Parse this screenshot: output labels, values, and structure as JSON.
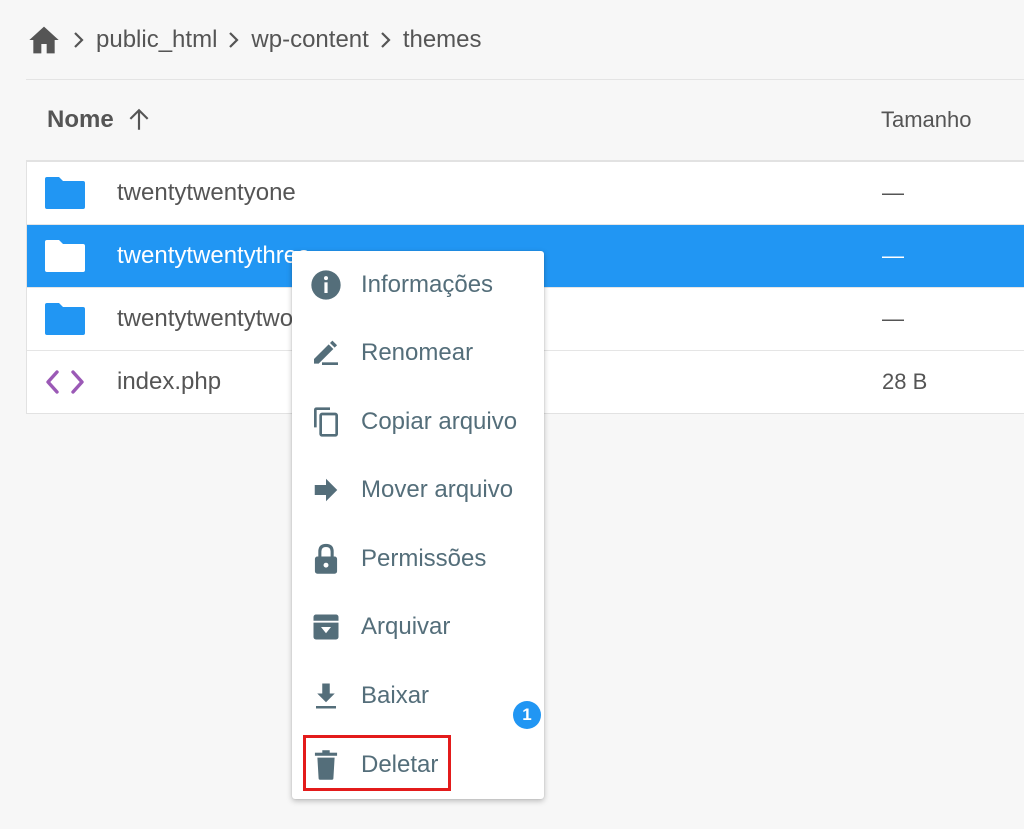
{
  "breadcrumb": {
    "home_icon": "home-icon",
    "items": [
      "public_html",
      "wp-content",
      "themes"
    ]
  },
  "table": {
    "headers": {
      "name": "Nome",
      "size": "Tamanho"
    },
    "sort_icon": "arrow-up-icon",
    "rows": [
      {
        "name": "twentytwentyone",
        "size": "—",
        "type": "folder"
      },
      {
        "name": "twentytwentythree",
        "size": "—",
        "type": "folder",
        "selected": true
      },
      {
        "name": "twentytwentytwo",
        "size": "—",
        "type": "folder"
      },
      {
        "name": "index.php",
        "size": "28 B",
        "type": "code"
      }
    ]
  },
  "context_menu": {
    "items": [
      {
        "label": "Informações",
        "icon": "info-icon"
      },
      {
        "label": "Renomear",
        "icon": "rename-pen-icon"
      },
      {
        "label": "Copiar arquivo",
        "icon": "copy-icon"
      },
      {
        "label": "Mover arquivo",
        "icon": "move-arrow-icon"
      },
      {
        "label": "Permissões",
        "icon": "lock-icon"
      },
      {
        "label": "Arquivar",
        "icon": "archive-icon"
      },
      {
        "label": "Baixar",
        "icon": "download-icon"
      },
      {
        "label": "Deletar",
        "icon": "trash-icon"
      }
    ]
  },
  "annotation": {
    "badge": "1"
  },
  "colors": {
    "accent": "#2196f3",
    "folder": "#2196f3",
    "code_icon": "#9b59b6",
    "menu_text": "#546e7a",
    "highlight": "#e31b1b"
  }
}
